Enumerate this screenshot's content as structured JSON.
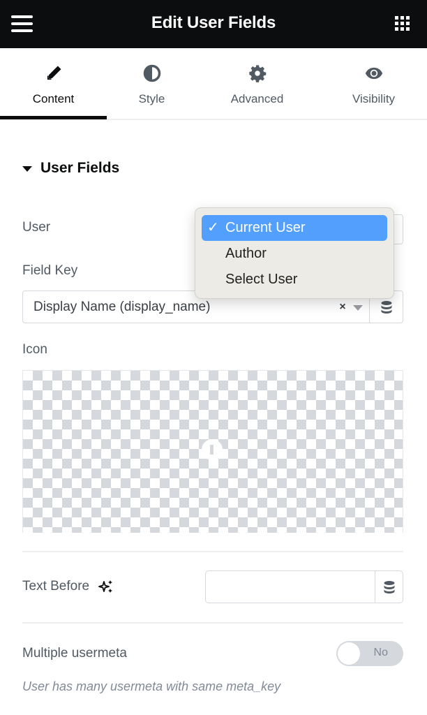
{
  "header": {
    "title": "Edit User Fields",
    "menu_icon": "hamburger-icon",
    "apps_icon": "grid-icon"
  },
  "tabs": [
    {
      "label": "Content",
      "icon": "pencil-icon",
      "active": true
    },
    {
      "label": "Style",
      "icon": "half-circle-icon",
      "active": false
    },
    {
      "label": "Advanced",
      "icon": "gear-icon",
      "active": false
    },
    {
      "label": "Visibility",
      "icon": "eye-icon",
      "active": false
    }
  ],
  "section": {
    "title": "User Fields",
    "expanded": true
  },
  "fields": {
    "user": {
      "label": "User",
      "value": "Current User",
      "options": [
        "Current User",
        "Author",
        "Select User"
      ]
    },
    "field_key": {
      "label": "Field Key",
      "value": "Display Name (display_name)",
      "clear_label": "×"
    },
    "icon": {
      "label": "Icon"
    },
    "text_before": {
      "label": "Text Before",
      "value": "",
      "placeholder": ""
    },
    "multiple_usermeta": {
      "label": "Multiple usermeta",
      "toggle_label": "No",
      "enabled": false,
      "help": "User has many usermeta with same meta_key"
    }
  },
  "colors": {
    "header_bg": "#0c0d0e",
    "dropdown_selected": "#539ffd",
    "text": "#515962"
  }
}
